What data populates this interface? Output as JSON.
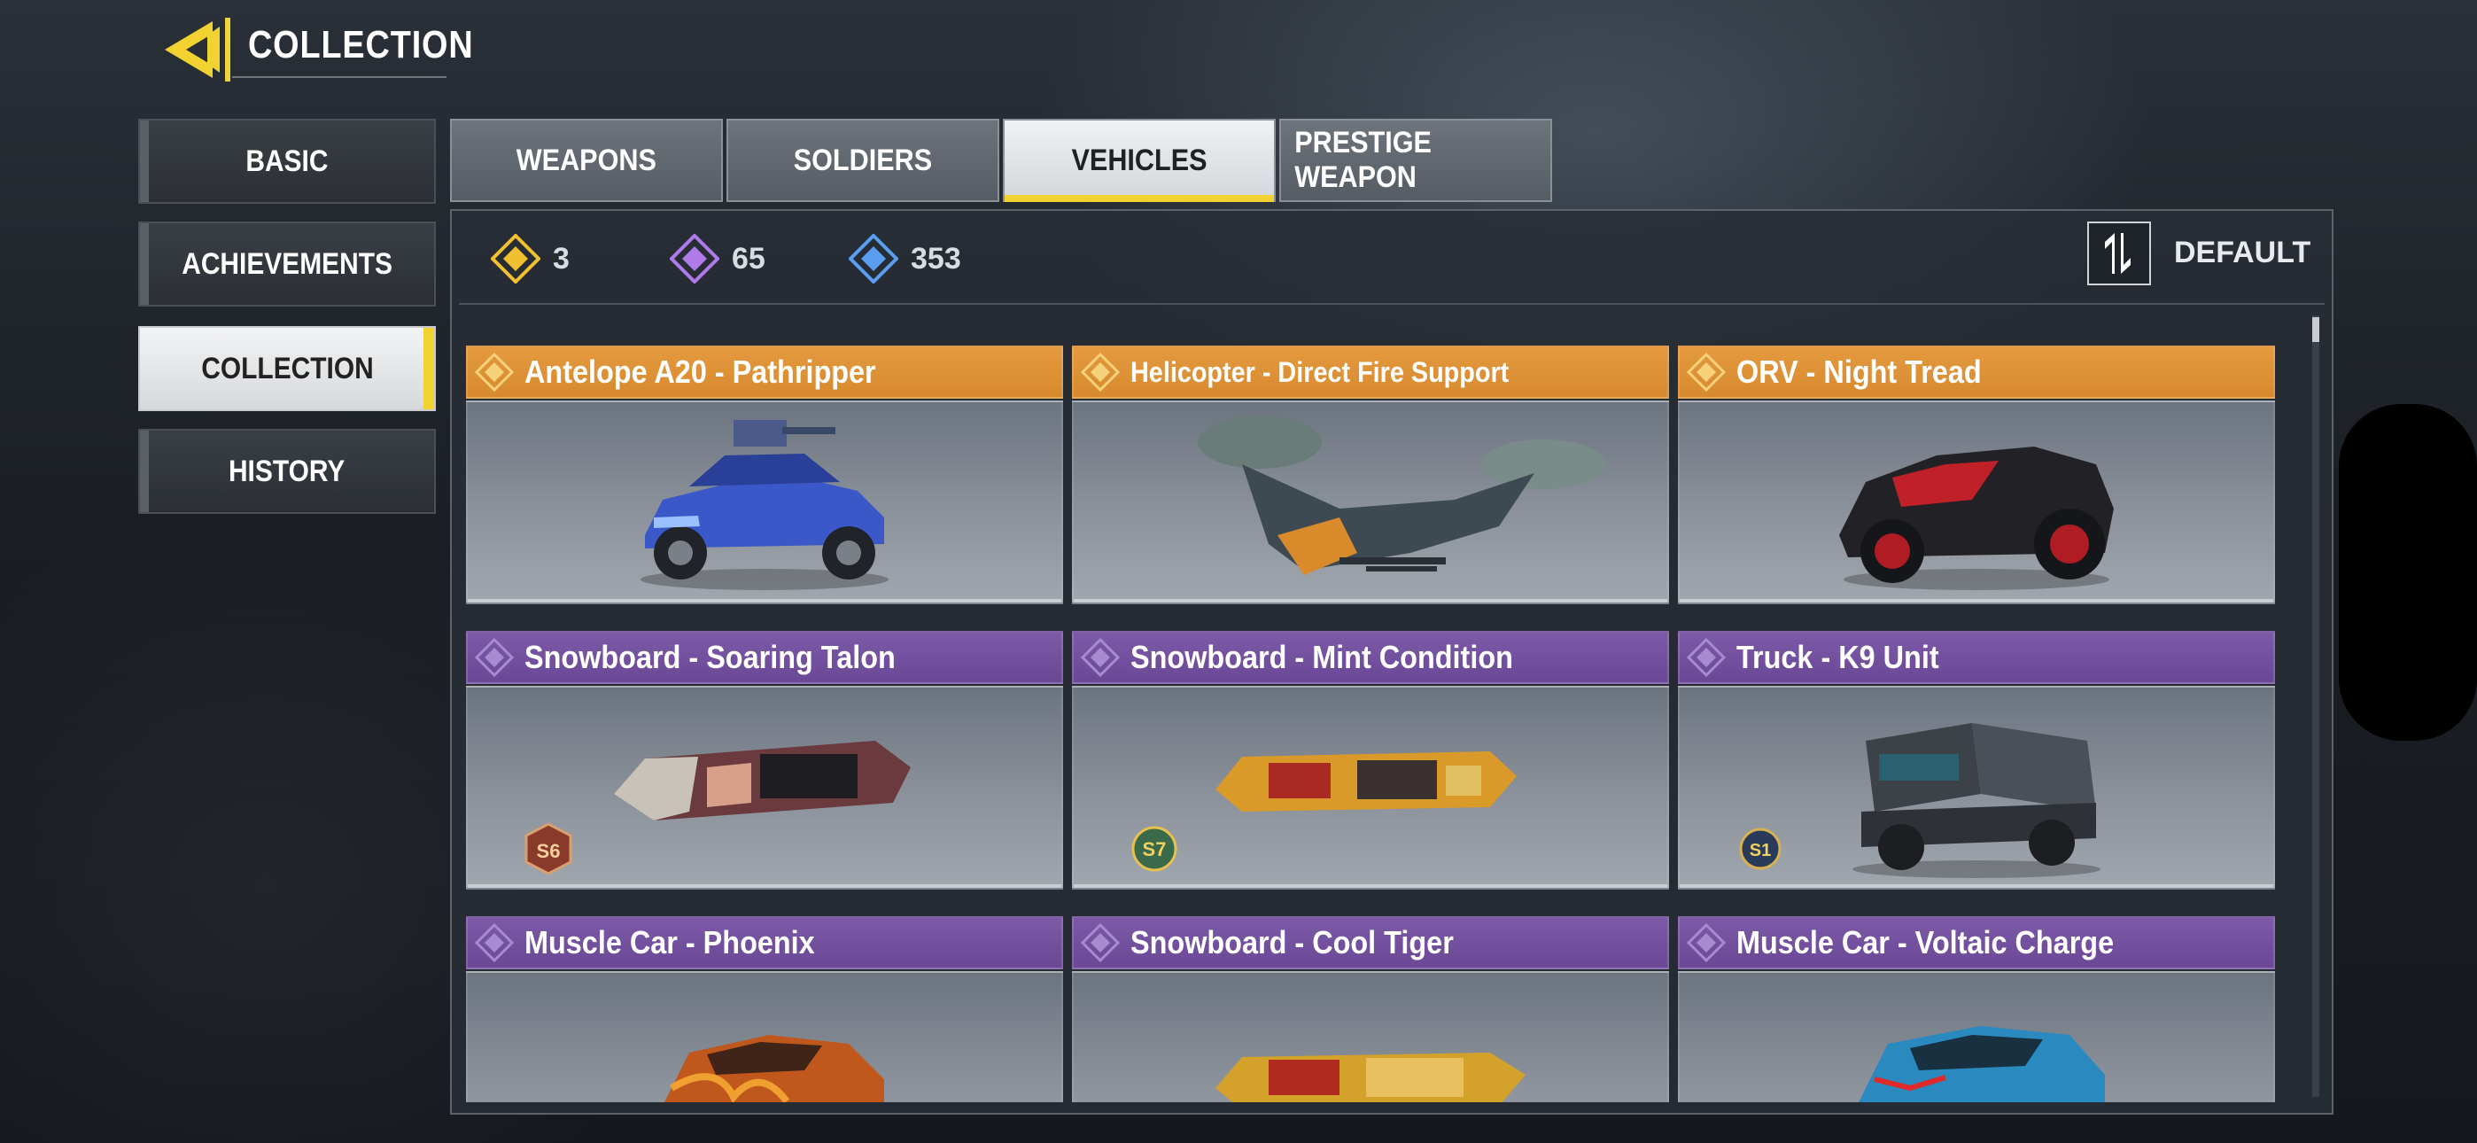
{
  "header": {
    "title": "COLLECTION"
  },
  "sidebar": {
    "items": [
      {
        "label": "BASIC"
      },
      {
        "label": "ACHIEVEMENTS"
      },
      {
        "label": "COLLECTION"
      },
      {
        "label": "HISTORY"
      }
    ],
    "active": "COLLECTION"
  },
  "tabs": {
    "items": [
      {
        "label": "WEAPONS"
      },
      {
        "label": "SOLDIERS"
      },
      {
        "label": "VEHICLES"
      },
      {
        "label": "PRESTIGE WEAPON"
      }
    ],
    "active": "VEHICLES"
  },
  "counters": [
    {
      "rarity": "legendary",
      "color": "#f0c030",
      "value": "3"
    },
    {
      "rarity": "epic",
      "color": "#b07ae8",
      "value": "65"
    },
    {
      "rarity": "rare",
      "color": "#5a9ef0",
      "value": "353"
    }
  ],
  "sort": {
    "label": "DEFAULT",
    "icon": "sort-swap-icon"
  },
  "cards": [
    {
      "name": "Antelope A20 - Pathripper",
      "rarity": "legendary",
      "badge": ""
    },
    {
      "name": "Helicopter - Direct Fire Support",
      "rarity": "legendary",
      "badge": ""
    },
    {
      "name": "ORV - Night Tread",
      "rarity": "legendary",
      "badge": ""
    },
    {
      "name": "Snowboard - Soaring Talon",
      "rarity": "epic",
      "badge": "S6"
    },
    {
      "name": "Snowboard - Mint Condition",
      "rarity": "epic",
      "badge": "S7"
    },
    {
      "name": "Truck - K9 Unit",
      "rarity": "epic",
      "badge": "S1"
    },
    {
      "name": "Muscle Car - Phoenix",
      "rarity": "epic",
      "badge": ""
    },
    {
      "name": "Snowboard - Cool Tiger",
      "rarity": "epic",
      "badge": ""
    },
    {
      "name": "Muscle Car - Voltaic Charge",
      "rarity": "epic",
      "badge": ""
    }
  ]
}
